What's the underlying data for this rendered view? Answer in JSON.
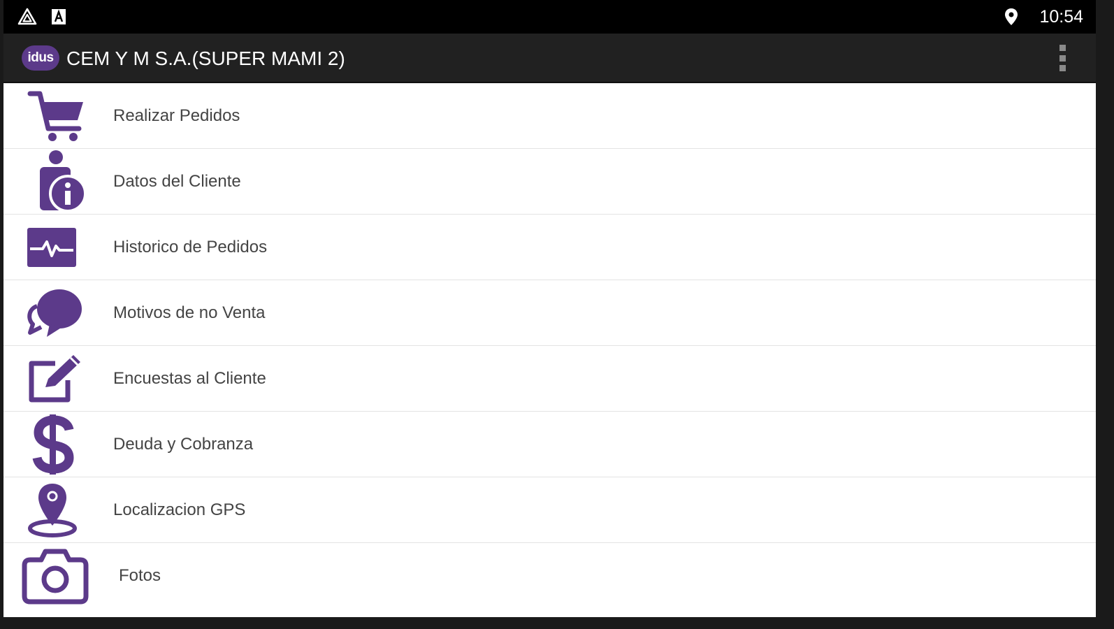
{
  "status_bar": {
    "time": "10:54",
    "left_icons": [
      "drive-icon",
      "a-badge-icon"
    ],
    "right_icons": [
      "location-pin-icon"
    ]
  },
  "app_bar": {
    "logo_text": "idus",
    "title": "CEM Y M S.A.(SUPER MAMI 2)",
    "menu_icon": "overflow-menu-icon"
  },
  "colors": {
    "accent": "#5c3a8a",
    "status_bar_bg": "#000000",
    "app_bar_bg": "#212121",
    "list_text": "#444444"
  },
  "menu": {
    "items": [
      {
        "label": "Realizar Pedidos",
        "icon": "shopping-cart-icon"
      },
      {
        "label": "Datos del Cliente",
        "icon": "client-info-icon"
      },
      {
        "label": "Historico de Pedidos",
        "icon": "pulse-monitor-icon"
      },
      {
        "label": "Motivos de no Venta",
        "icon": "speech-bubbles-icon"
      },
      {
        "label": "Encuestas al Cliente",
        "icon": "edit-survey-icon"
      },
      {
        "label": "Deuda y Cobranza",
        "icon": "dollar-icon"
      },
      {
        "label": "Localizacion GPS",
        "icon": "gps-pin-icon"
      },
      {
        "label": "Fotos",
        "icon": "camera-icon"
      }
    ]
  }
}
